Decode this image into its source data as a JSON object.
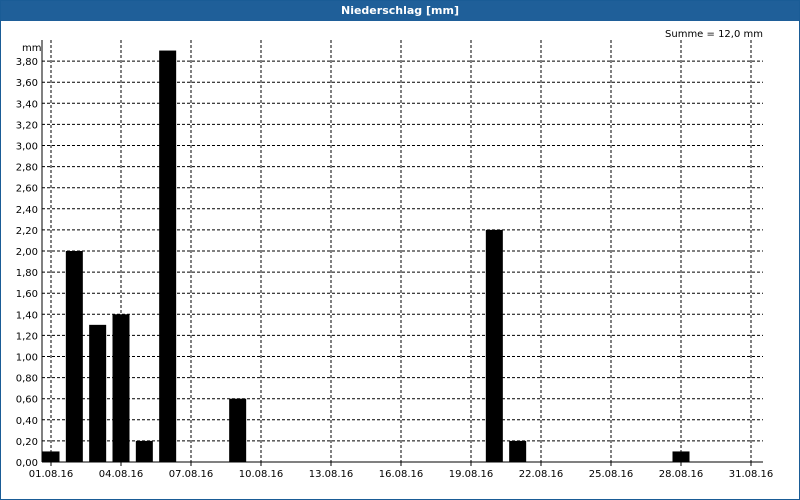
{
  "window": {
    "title": "Niederschlag [mm]"
  },
  "chart_data": {
    "type": "bar",
    "title": "Niederschlag [mm]",
    "ylabel": "mm",
    "summary": "Summe = 12,0 mm",
    "ylim": [
      0,
      4.0
    ],
    "yticks": [
      "0,00",
      "0,20",
      "0,40",
      "0,60",
      "0,80",
      "1,00",
      "1,20",
      "1,40",
      "1,60",
      "1,80",
      "2,00",
      "2,20",
      "2,40",
      "2,60",
      "2,80",
      "3,00",
      "3,20",
      "3,40",
      "3,60",
      "3,80"
    ],
    "xtick_labels": [
      "01.08.16",
      "04.08.16",
      "07.08.16",
      "10.08.16",
      "13.08.16",
      "16.08.16",
      "19.08.16",
      "22.08.16",
      "25.08.16",
      "28.08.16",
      "31.08.16"
    ],
    "grid": true,
    "bar_color": "#000000",
    "categories": [
      "01.08.16",
      "02.08.16",
      "03.08.16",
      "04.08.16",
      "05.08.16",
      "06.08.16",
      "07.08.16",
      "08.08.16",
      "09.08.16",
      "10.08.16",
      "11.08.16",
      "12.08.16",
      "13.08.16",
      "14.08.16",
      "15.08.16",
      "16.08.16",
      "17.08.16",
      "18.08.16",
      "19.08.16",
      "20.08.16",
      "21.08.16",
      "22.08.16",
      "23.08.16",
      "24.08.16",
      "25.08.16",
      "26.08.16",
      "27.08.16",
      "28.08.16",
      "29.08.16",
      "30.08.16",
      "31.08.16"
    ],
    "values": [
      0.1,
      2.0,
      1.3,
      1.4,
      0.2,
      3.9,
      0,
      0,
      0.6,
      0,
      0,
      0,
      0,
      0,
      0,
      0,
      0,
      0,
      0,
      2.2,
      0.2,
      0,
      0,
      0,
      0,
      0,
      0,
      0.1,
      0,
      0,
      0
    ]
  }
}
